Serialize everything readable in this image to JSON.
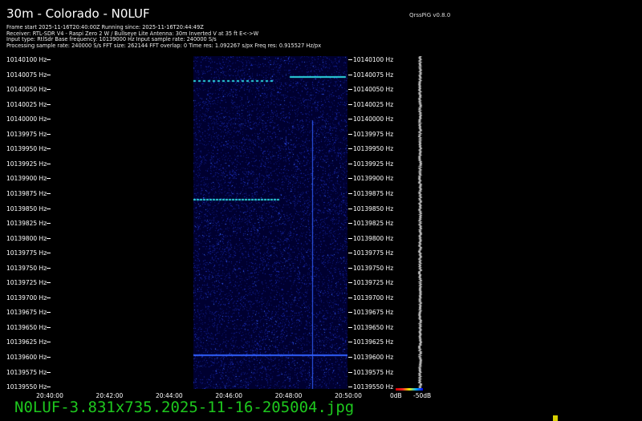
{
  "header": {
    "title": "30m - Colorado - N0LUF",
    "version": "QrssPiG v0.8.0",
    "info": [
      "Frame start 2025-11-16T20:40:00Z Running since: 2025-11-16T20:44:49Z",
      "Receiver: RTL-SDR V4 - Raspi Zero 2 W / Bullseye Lite Antenna: 30m Inverted V at 35 ft E<->W",
      "Input type: RtlSdr Base frequency: 10139000 Hz Input sample rate: 240000 S/s",
      "Processing sample rate: 240000 S/s FFT size: 262144 FFT overlap: 0 Time res: 1.092267 s/px Freq res: 0.915527 Hz/px"
    ]
  },
  "freq_labels": [
    "10140100 Hz",
    "10140075 Hz",
    "10140050 Hz",
    "10140025 Hz",
    "10140000 Hz",
    "10139975 Hz",
    "10139950 Hz",
    "10139925 Hz",
    "10139900 Hz",
    "10139875 Hz",
    "10139850 Hz",
    "10139825 Hz",
    "10139800 Hz",
    "10139775 Hz",
    "10139750 Hz",
    "10139725 Hz",
    "10139700 Hz",
    "10139675 Hz",
    "10139650 Hz",
    "10139625 Hz",
    "10139600 Hz",
    "10139575 Hz",
    "10139550 Hz"
  ],
  "time_labels": [
    "20:40:00",
    "20:42:00",
    "20:44:00",
    "20:46:00",
    "20:48:00",
    "20:50:00"
  ],
  "db_scale": {
    "min": "0dB",
    "max": "-50dB"
  },
  "filename": "N0LUF-3.831x735.2025-11-16-205004.jpg"
}
